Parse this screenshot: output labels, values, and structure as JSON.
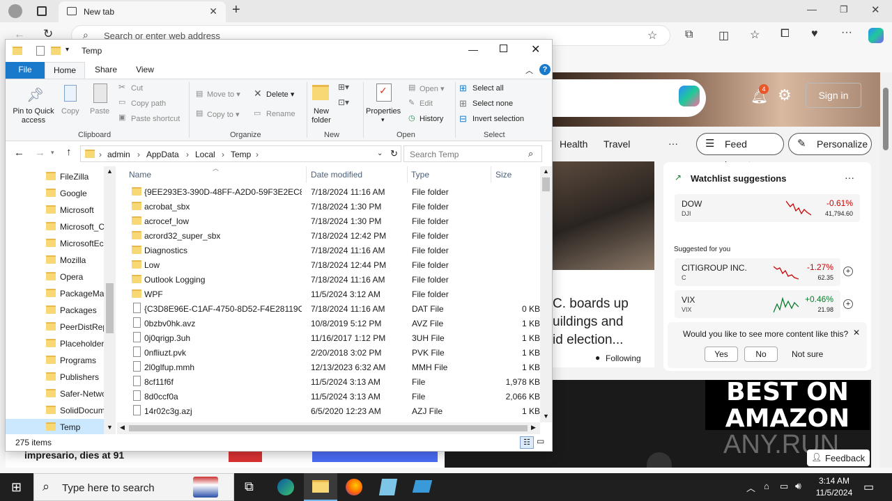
{
  "browser": {
    "tab_title": "New tab",
    "address_placeholder": "Search or enter web address"
  },
  "news_page": {
    "sign_in": "Sign in",
    "notification_count": "4",
    "nav_items": [
      "Health",
      "Travel",
      "···"
    ],
    "feed_layout": "Feed layout",
    "personalize": "Personalize",
    "headline_lines": [
      "C. boards up",
      "uildings and",
      "id election..."
    ],
    "following": "Following",
    "watchlist_title": "Watchlist suggestions",
    "watchlist_more": "···",
    "suggested_label": "Suggested for you",
    "stocks": [
      {
        "name": "DOW",
        "symbol": "DJI",
        "change": "-0.61%",
        "value": "41,794.60",
        "trend": "down"
      },
      {
        "name": "CITIGROUP INC.",
        "symbol": "C",
        "change": "-1.27%",
        "value": "62.35",
        "trend": "down"
      },
      {
        "name": "VIX",
        "symbol": "VIX",
        "change": "+0.46%",
        "value": "21.98",
        "trend": "up"
      }
    ],
    "feedback_question": "Would you like to see more content like this?",
    "feedback_options": [
      "Yes",
      "No",
      "Not sure"
    ],
    "promo_text": [
      "BEST ON",
      "AMAZON"
    ],
    "bottom_headline": "impresario, dies at 91",
    "feedback_button": "Feedback",
    "watermark": "ANY.RUN"
  },
  "explorer": {
    "window_title": "Temp",
    "menu_tabs": [
      "File",
      "Home",
      "Share",
      "View"
    ],
    "ribbon": {
      "pin": [
        "Pin to Quick",
        "access"
      ],
      "copy": "Copy",
      "paste": "Paste",
      "cut": "Cut",
      "copy_path": "Copy path",
      "paste_shortcut": "Paste shortcut",
      "move_to": "Move to",
      "copy_to": "Copy to",
      "delete": "Delete",
      "rename": "Rename",
      "new_folder": [
        "New",
        "folder"
      ],
      "properties": "Properties",
      "open": "Open",
      "edit": "Edit",
      "history": "History",
      "select_all": "Select all",
      "select_none": "Select none",
      "invert_selection": "Invert selection",
      "groups": [
        "Clipboard",
        "Organize",
        "New",
        "Open",
        "Select"
      ]
    },
    "breadcrumb": [
      "admin",
      "AppData",
      "Local",
      "Temp"
    ],
    "search_placeholder": "Search Temp",
    "nav_items": [
      "FileZilla",
      "Google",
      "Microsoft",
      "Microsoft_C",
      "MicrosoftEc",
      "Mozilla",
      "Opera",
      "PackageMa",
      "Packages",
      "PeerDistRep",
      "Placeholder",
      "Programs",
      "Publishers",
      "Safer-Netwo",
      "SolidDocum",
      "Temp"
    ],
    "nav_selected": "Temp",
    "columns": [
      "Name",
      "Date modified",
      "Type",
      "Size"
    ],
    "files": [
      {
        "name": "{9EE293E3-390D-48FF-A2D0-59F3E2EC88...",
        "date": "7/18/2024 11:16 AM",
        "type": "File folder",
        "size": "",
        "kind": "folder"
      },
      {
        "name": "acrobat_sbx",
        "date": "7/18/2024 1:30 PM",
        "type": "File folder",
        "size": "",
        "kind": "folder"
      },
      {
        "name": "acrocef_low",
        "date": "7/18/2024 1:30 PM",
        "type": "File folder",
        "size": "",
        "kind": "folder"
      },
      {
        "name": "acrord32_super_sbx",
        "date": "7/18/2024 12:42 PM",
        "type": "File folder",
        "size": "",
        "kind": "folder"
      },
      {
        "name": "Diagnostics",
        "date": "7/18/2024 11:16 AM",
        "type": "File folder",
        "size": "",
        "kind": "folder"
      },
      {
        "name": "Low",
        "date": "7/18/2024 12:44 PM",
        "type": "File folder",
        "size": "",
        "kind": "folder"
      },
      {
        "name": "Outlook Logging",
        "date": "7/18/2024 11:16 AM",
        "type": "File folder",
        "size": "",
        "kind": "folder"
      },
      {
        "name": "WPF",
        "date": "11/5/2024 3:12 AM",
        "type": "File folder",
        "size": "",
        "kind": "folder"
      },
      {
        "name": "{C3D8E96E-C1AF-4750-8D52-F4E28119C1...",
        "date": "7/18/2024 11:16 AM",
        "type": "DAT File",
        "size": "0 KB",
        "kind": "file"
      },
      {
        "name": "0bzbv0hk.avz",
        "date": "10/8/2019 5:12 PM",
        "type": "AVZ File",
        "size": "1 KB",
        "kind": "file"
      },
      {
        "name": "0j0qrigp.3uh",
        "date": "11/16/2017 1:12 PM",
        "type": "3UH File",
        "size": "1 KB",
        "kind": "file"
      },
      {
        "name": "0nfliuzt.pvk",
        "date": "2/20/2018 3:02 PM",
        "type": "PVK File",
        "size": "1 KB",
        "kind": "file"
      },
      {
        "name": "2l0glfup.mmh",
        "date": "12/13/2023 6:32 AM",
        "type": "MMH File",
        "size": "1 KB",
        "kind": "file"
      },
      {
        "name": "8cf11f6f",
        "date": "11/5/2024 3:13 AM",
        "type": "File",
        "size": "1,978 KB",
        "kind": "file"
      },
      {
        "name": "8d0ccf0a",
        "date": "11/5/2024 3:13 AM",
        "type": "File",
        "size": "2,066 KB",
        "kind": "file"
      },
      {
        "name": "14r02c3g.azj",
        "date": "6/5/2020 12:23 AM",
        "type": "AZJ File",
        "size": "1 KB",
        "kind": "file"
      }
    ],
    "status": "275 items"
  },
  "taskbar": {
    "search_placeholder": "Type here to search",
    "time": "3:14 AM",
    "date": "11/5/2024"
  }
}
